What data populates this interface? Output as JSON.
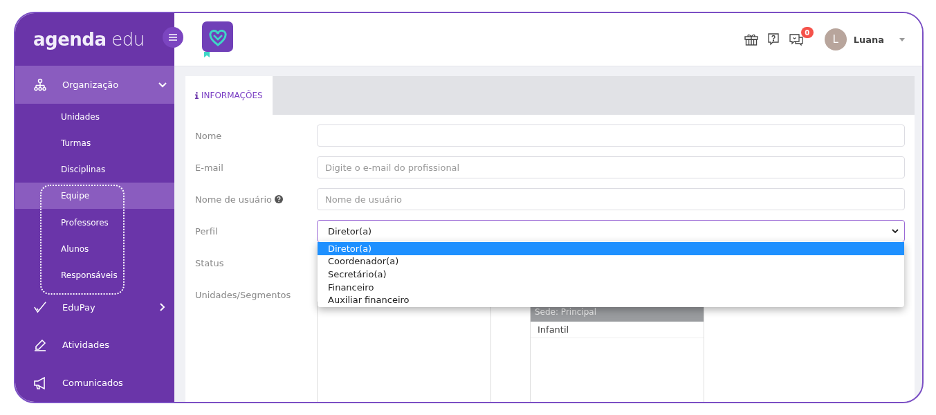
{
  "sidebar": {
    "logo": "**agenda** edu",
    "items": [
      {
        "label": "Organização",
        "kind": "group",
        "expanded": true,
        "selected": true,
        "children": [
          {
            "label": "Unidades",
            "selected": false
          },
          {
            "label": "Turmas",
            "selected": false
          },
          {
            "label": "Disciplinas",
            "selected": false
          },
          {
            "label": "Equipe",
            "selected": true
          },
          {
            "label": "Professores",
            "selected": false
          },
          {
            "label": "Alunos",
            "selected": false
          },
          {
            "label": "Responsáveis",
            "selected": false
          }
        ]
      },
      {
        "label": "EduPay",
        "kind": "group",
        "expanded": false,
        "selected": false
      },
      {
        "label": "Atividades",
        "kind": "link",
        "selected": false
      },
      {
        "label": "Comunicados",
        "kind": "link",
        "selected": false
      }
    ]
  },
  "header": {
    "notifications": "0",
    "user": {
      "initial": "L",
      "name": "Luana"
    }
  },
  "tabs": [
    {
      "label": "INFORMAÇÕES",
      "selected": true
    }
  ],
  "form": {
    "fields": [
      {
        "label": "Nome",
        "kind": "text"
      },
      {
        "label": "E-mail",
        "kind": "text",
        "placeholder": "Digite o e-mail do profissional"
      },
      {
        "label": "Nome de usuário",
        "kind": "text",
        "help": true,
        "placeholder": "Nome de usuário"
      },
      {
        "label": "Perfil",
        "kind": "select",
        "value": "Diretor(a)",
        "open": true,
        "options": [
          {
            "label": "Diretor(a)",
            "selected": true
          },
          {
            "label": "Coordenador(a)",
            "selected": false
          },
          {
            "label": "Secretário(a)",
            "selected": false
          },
          {
            "label": "Financeiro",
            "selected": false
          },
          {
            "label": "Auxiliar financeiro",
            "selected": false
          }
        ]
      },
      {
        "label": "Status",
        "kind": "covered"
      },
      {
        "label": "Unidades/Segmentos",
        "kind": "transfer",
        "groups": [
          {
            "title": "Sede: Principal",
            "items": [
              "Infantil"
            ]
          }
        ]
      }
    ]
  }
}
